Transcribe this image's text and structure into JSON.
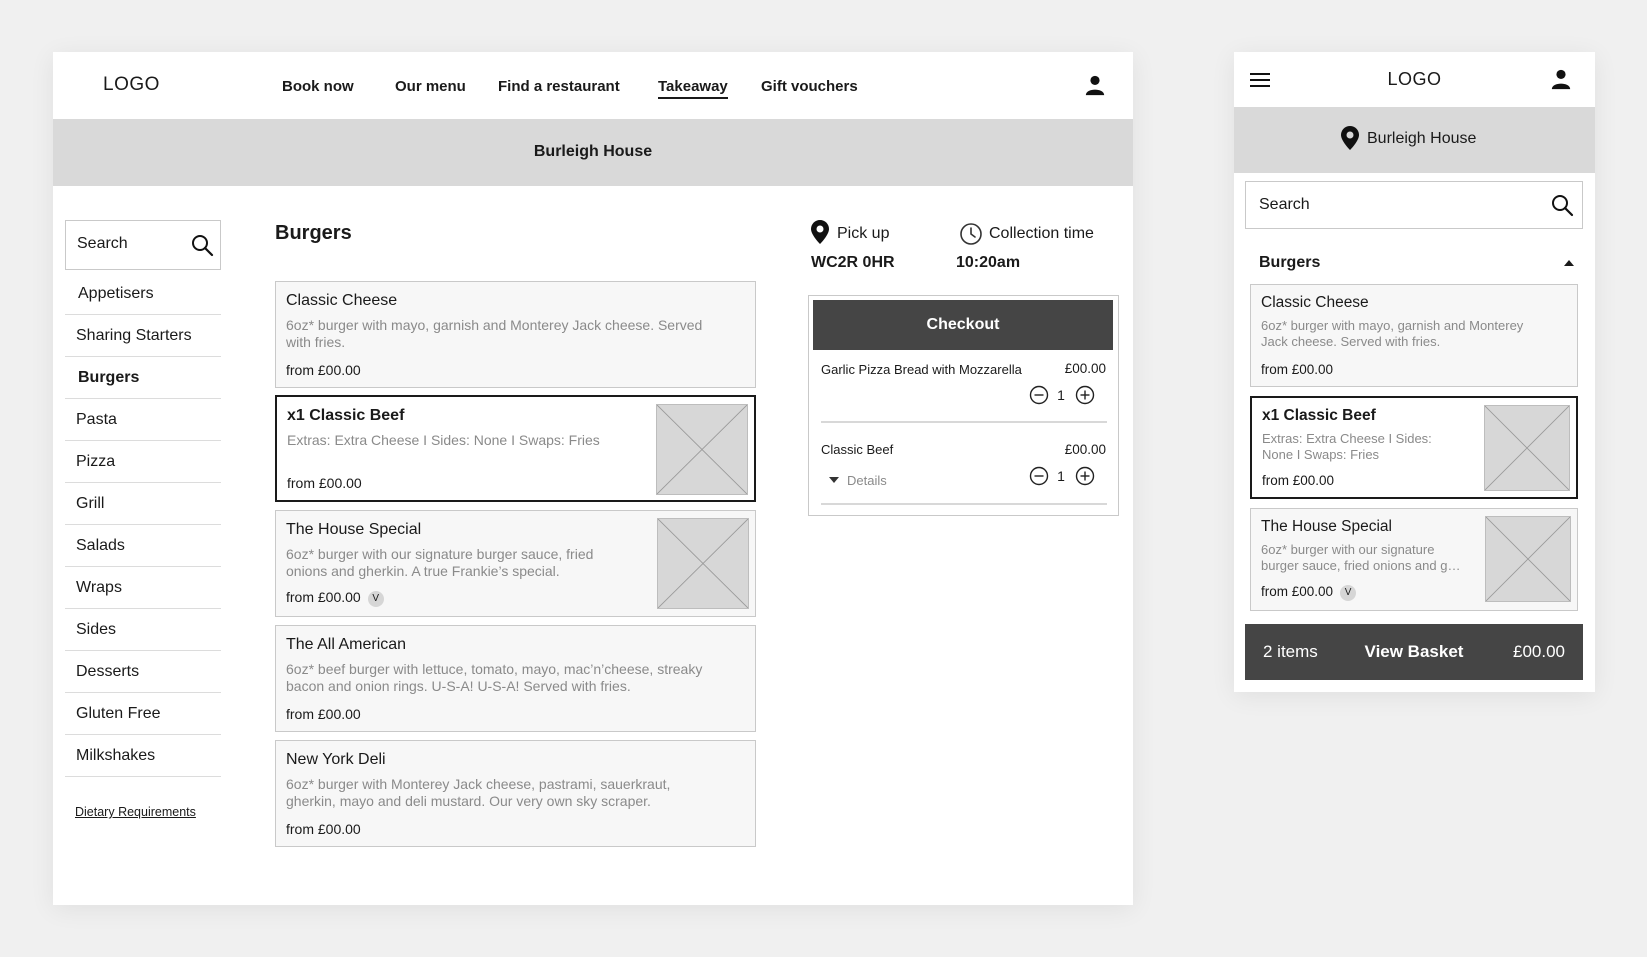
{
  "desktop": {
    "logo": "LOGO",
    "nav": [
      {
        "label": "Book now",
        "active": false
      },
      {
        "label": "Our menu",
        "active": false
      },
      {
        "label": "Find a restaurant",
        "active": false
      },
      {
        "label": "Takeaway",
        "active": true
      },
      {
        "label": "Gift vouchers",
        "active": false
      }
    ],
    "user_icon": "user-icon",
    "banner_title": "Burleigh House",
    "search_placeholder": "Search",
    "categories": [
      {
        "label": "Appetisers",
        "active": false
      },
      {
        "label": "Sharing Starters",
        "active": false
      },
      {
        "label": "Burgers",
        "active": true
      },
      {
        "label": "Pasta",
        "active": false
      },
      {
        "label": "Pizza",
        "active": false
      },
      {
        "label": "Grill",
        "active": false
      },
      {
        "label": "Salads",
        "active": false
      },
      {
        "label": "Wraps",
        "active": false
      },
      {
        "label": "Sides",
        "active": false
      },
      {
        "label": "Desserts",
        "active": false
      },
      {
        "label": "Gluten Free",
        "active": false
      },
      {
        "label": "Milkshakes",
        "active": false
      }
    ],
    "dietary_link": "Dietary Requirements",
    "section_title": "Burgers",
    "menu_items": [
      {
        "title": "Classic Cheese",
        "desc_lines": [
          "6oz* burger with mayo, garnish and Monterey Jack cheese. Served",
          "with fries."
        ],
        "price": "from £00.00",
        "veg": "",
        "image": false,
        "selected": false
      },
      {
        "title": "x1 Classic Beef",
        "desc_lines": [
          "Extras: Extra Cheese I Sides: None I Swaps: Fries"
        ],
        "price": "from £00.00",
        "veg": "",
        "image": true,
        "selected": true
      },
      {
        "title": "The House Special",
        "desc_lines": [
          "6oz* burger with our signature burger sauce, fried",
          "onions and gherkin. A true Frankie’s special."
        ],
        "price": "from £00.00",
        "veg": "V",
        "image": true,
        "selected": false
      },
      {
        "title": "The All American",
        "desc_lines": [
          "6oz* beef burger with lettuce, tomato, mayo, mac’n’cheese, streaky",
          "bacon and onion rings. U-S-A! U-S-A! Served with fries."
        ],
        "price": "from £00.00",
        "veg": "",
        "image": false,
        "selected": false
      },
      {
        "title": "New York Deli",
        "desc_lines": [
          "6oz* burger with Monterey Jack cheese, pastrami, sauerkraut,",
          "gherkin, mayo and deli mustard. Our very own sky scraper."
        ],
        "price": "from £00.00",
        "veg": "",
        "image": false,
        "selected": false
      }
    ],
    "pickup": {
      "label": "Pick up",
      "value": "WC2R 0HR"
    },
    "collection": {
      "label": "Collection time",
      "value": "10:20am"
    },
    "basket": {
      "checkout_label": "Checkout",
      "items": [
        {
          "name": "Garlic Pizza Bread with Mozzarella",
          "price": "£00.00",
          "qty": "1"
        },
        {
          "name": "Classic Beef",
          "price": "£00.00",
          "qty": "1",
          "details": "Details"
        }
      ]
    }
  },
  "mobile": {
    "logo": "LOGO",
    "banner_title": "Burleigh House",
    "search_placeholder": "Search",
    "section_title": "Burgers",
    "menu_items": [
      {
        "title": "Classic Cheese",
        "desc_lines": [
          "6oz* burger with mayo, garnish and Monterey",
          "Jack cheese. Served with fries."
        ],
        "price": "from £00.00",
        "veg": "",
        "image": false,
        "selected": false
      },
      {
        "title": "x1 Classic Beef",
        "desc_lines": [
          "Extras: Extra Cheese I Sides:",
          "None I Swaps: Fries"
        ],
        "price": "from £00.00",
        "veg": "",
        "image": true,
        "selected": true
      },
      {
        "title": "The House Special",
        "desc_lines": [
          "6oz* burger with our signature",
          "burger sauce, fried onions and g…"
        ],
        "price": "from £00.00",
        "veg": "V",
        "image": true,
        "selected": false
      }
    ],
    "view_basket": {
      "count": "2 items",
      "label": "View Basket",
      "total": "£00.00"
    }
  }
}
